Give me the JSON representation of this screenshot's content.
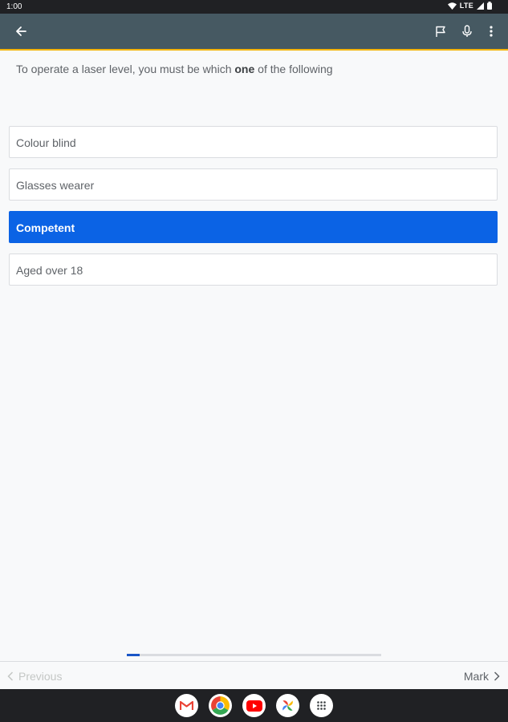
{
  "status_bar": {
    "time": "1:00",
    "network": "LTE",
    "icons": [
      "wifi-icon",
      "signal-icon",
      "battery-icon"
    ]
  },
  "app_bar": {
    "background": "#465962",
    "accent": "#f5b400",
    "icons": [
      "back-arrow-icon",
      "flag-icon",
      "microphone-icon",
      "more-vert-icon"
    ]
  },
  "question": {
    "prefix": "To operate a laser level, you must be which ",
    "emphasis": "one",
    "suffix": " of the following"
  },
  "options": [
    {
      "label": "Colour blind",
      "selected": false
    },
    {
      "label": "Glasses wearer",
      "selected": false
    },
    {
      "label": "Competent",
      "selected": true
    },
    {
      "label": "Aged over 18",
      "selected": false
    }
  ],
  "selected_color": "#0b63e5",
  "progress": {
    "fraction": 0.05
  },
  "bottom_nav": {
    "previous_label": "Previous",
    "mark_label": "Mark"
  },
  "dock": {
    "apps": [
      "gmail-icon",
      "chrome-icon",
      "youtube-icon",
      "photos-icon",
      "app-drawer-icon"
    ]
  }
}
